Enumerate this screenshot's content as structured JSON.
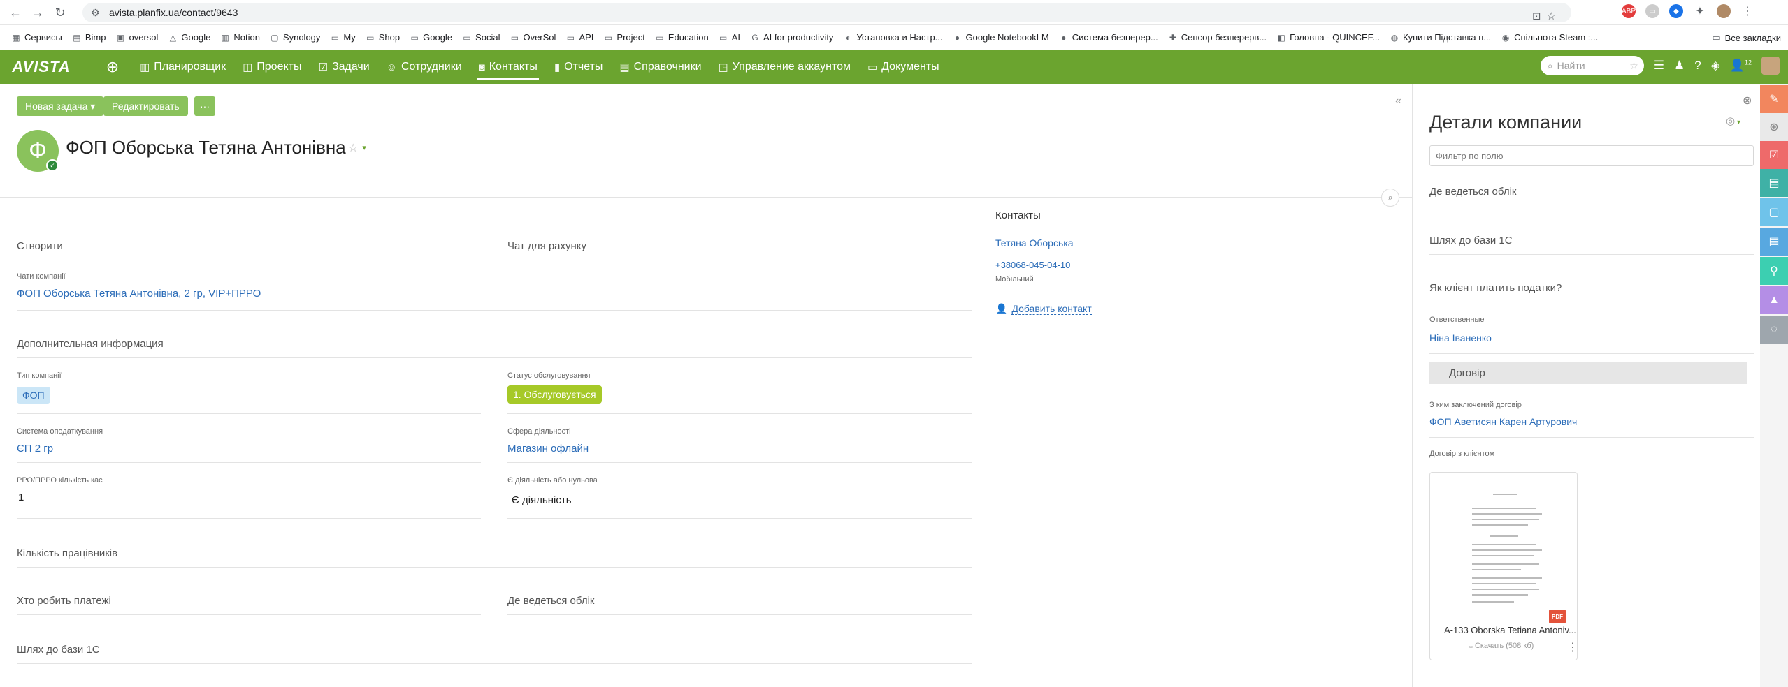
{
  "browser": {
    "url": "avista.planfix.ua/contact/9643",
    "bookmarks": [
      "Сервисы",
      "Bimp",
      "oversol",
      "Google",
      "Notion",
      "Synology",
      "My",
      "Shop",
      "Google",
      "Social",
      "OverSol",
      "API",
      "Project",
      "Education",
      "AI",
      "AI for productivity",
      "Установка и Настр...",
      "Google NotebookLM",
      "Система безперер...",
      "Сенсор безперерв...",
      "Головна - QUINCEF...",
      "Купити Підставка п...",
      "Спільнота Steam :..."
    ],
    "all_bookmarks": "Все закладки"
  },
  "header": {
    "logo": "AVISTA",
    "menu": [
      "Планировщик",
      "Проекты",
      "Задачи",
      "Сотрудники",
      "Контакты",
      "Отчеты",
      "Справочники",
      "Управление аккаунтом",
      "Документы"
    ],
    "search_placeholder": "Найти",
    "notif_count": "12"
  },
  "toolbar": {
    "new_task": "Новая задача ▾",
    "edit": "Редактировать",
    "more": "···"
  },
  "company": {
    "avatar_letter": "Ф",
    "name": "ФОП Оборська Тетяна Антонівна"
  },
  "sections": {
    "create": "Створити",
    "chat_for_account": "Чат для рахунку",
    "company_chats_label": "Чати компанії",
    "company_chats_value": "ФОП Оборська Тетяна Антонівна, 2 гр, VIP+ПРРО",
    "additional_info": "Дополнительная информация",
    "company_type_label": "Тип компанії",
    "company_type_value": "ФОП",
    "service_status_label": "Статус обслуговування",
    "service_status_value": "1. Обслуговується",
    "tax_system_label": "Система оподаткування",
    "tax_system_value": "ЄП 2 гр",
    "activity_label": "Сфера діяльності",
    "activity_value": "Магазин офлайн",
    "rro_label": "РРО/ПРРО кількість кас",
    "rro_value": "1",
    "activity_zero_label": "Є діяльність або нульова",
    "activity_zero_value": "Є діяльність",
    "employees": "Кількість працівників",
    "who_pays": "Хто робить платежі",
    "where_accounting": "Де ведеться облік",
    "path_1c": "Шлях до бази 1С"
  },
  "contacts": {
    "title": "Контакты",
    "person": "Тетяна Оборська",
    "phone": "+38068-045-04-10",
    "phone_type": "Мобільний",
    "add_contact": "Добавить контакт"
  },
  "panel": {
    "title": "Детали компании",
    "filter_placeholder": "Фильтр по полю",
    "where_accounting": "Де ведеться облік",
    "path_1c": "Шлях до бази 1С",
    "how_pays_taxes": "Як клієнт платить податки?",
    "responsible_label": "Ответственные",
    "responsible_value": "Ніна Іваненко",
    "contract_section": "Договір",
    "contract_with_label": "З ким заключений договір",
    "contract_with_value": "ФОП Аветисян Карен Артурович",
    "client_contract_label": "Договір з клієнтом",
    "file_name": "А-133 Oborska Tetiana Antoniv...",
    "file_download": "Скачать",
    "file_size": "(508 кб)",
    "pdf": "PDF"
  },
  "colors": {
    "header_green": "#6ba42f",
    "button_green": "#8ac25c",
    "link_blue": "#2b6cb8",
    "status_green": "#a6c928"
  },
  "strip_colors": [
    "#f2865e",
    "#e9e9e9",
    "#ee6a6a",
    "#3fb1a6",
    "#6fc3ea",
    "#58a8e0",
    "#3ccfb1",
    "#b48ee6",
    "#9ea6ad"
  ]
}
